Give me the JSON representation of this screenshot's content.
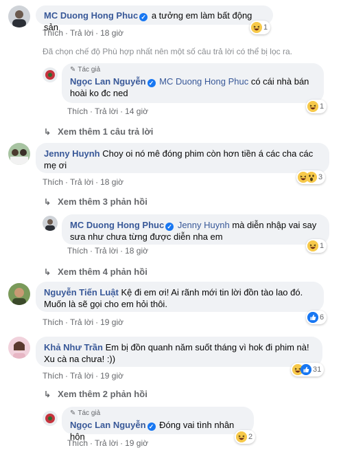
{
  "colors": {
    "name": "#385898",
    "bubble": "#f0f2f5",
    "meta": "#65676b",
    "verified": "#1877f2"
  },
  "comments": [
    {
      "author": "MC Duong Hong Phuc",
      "text": "a tưởng em làm bất động sản",
      "like": "Thích",
      "reply": "Trả lời",
      "time": "18 giờ",
      "reaction_count": "1"
    },
    {
      "filter_note": "Đã chọn chế độ Phù hợp nhất nên một số câu trả lời có thể bị lọc ra."
    },
    {
      "author_tag": "Tác giả",
      "author": "Ngọc Lan Nguyễn",
      "mention": "MC Duong Hong Phuc",
      "text": "có cái nhà bán hoài ko đc ned",
      "like": "Thích",
      "reply": "Trả lời",
      "time": "14 giờ",
      "reaction_count": "1"
    },
    {
      "more_label": "Xem thêm 1 câu trả lời"
    },
    {
      "author": "Jenny Huynh",
      "text": "Choy oi nó mê đóng phim còn hơn tiền á các cha các mẹ ơi",
      "like": "Thích",
      "reply": "Trả lời",
      "time": "18 giờ",
      "reaction_count": "3"
    },
    {
      "more_label": "Xem thêm 3 phản hồi"
    },
    {
      "author": "MC Duong Hong Phuc",
      "mention": "Jenny Huynh",
      "text": "mà diễn nhập vai say sưa như chưa từng được diễn nha em",
      "like": "Thích",
      "reply": "Trả lời",
      "time": "18 giờ",
      "reaction_count": "1"
    },
    {
      "more_label": "Xem thêm 4 phản hồi"
    },
    {
      "author": "Nguyễn Tiến Luật",
      "text": "Kệ đi em ơi! Ai rãnh mới tin lời đồn tào lao đó. Muốn là sẽ gọi cho em hỏi thôi.",
      "like": "Thích",
      "reply": "Trả lời",
      "time": "19 giờ",
      "reaction_count": "6"
    },
    {
      "author": "Khả Như Trần",
      "text": "Em bị đồn quanh năm suốt tháng vì hok đi phim nà! Xu cà na chưa! :))",
      "like": "Thích",
      "reply": "Trả lời",
      "time": "19 giờ",
      "reaction_count": "31"
    },
    {
      "more_label": "Xem thêm 2 phản hồi"
    },
    {
      "author_tag": "Tác giả",
      "author": "Ngọc Lan Nguyễn",
      "text": "Đóng vai tình nhân hôn",
      "like": "Thích",
      "reply": "Trả lời",
      "time": "19 giờ",
      "reaction_count": "2"
    }
  ]
}
